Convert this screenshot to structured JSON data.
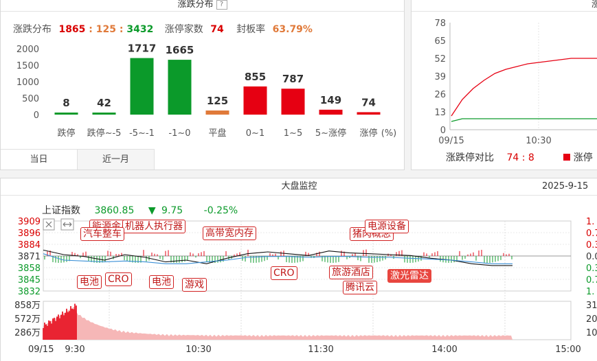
{
  "distribution": {
    "title": "涨跌分布",
    "help_icon": "?",
    "stat_label": "涨跌分布",
    "up_count": "1865",
    "sep1": " : ",
    "flat_count": "125",
    "sep2": " : ",
    "down_count": "3432",
    "limit_up_label": "涨停家数",
    "limit_up_value": "74",
    "seal_rate_label": "封板率",
    "seal_rate_value": "63.79%",
    "unit": "(%)",
    "tabs": [
      "当日",
      "近一月"
    ],
    "active_tab": 0
  },
  "ratio": {
    "title": "涨",
    "compare_label": "涨跌停对比",
    "compare_value": "74 : 8",
    "legend_label": "涨停",
    "y_ticks": [
      "78",
      "65",
      "52",
      "39",
      "26",
      "13",
      "0"
    ],
    "x_ticks": [
      "09/15",
      "10:30"
    ]
  },
  "monitor": {
    "title": "大盘监控",
    "date": "2025-9-15",
    "index_name": "上证指数",
    "index_value": "3860.85",
    "arrow": "▼",
    "change": "9.75",
    "change_pct": "-0.25%",
    "price_ticks": [
      "3909",
      "3896",
      "3884",
      "3871",
      "3858",
      "3845",
      "3832"
    ],
    "pct_ticks": [
      "1.",
      "0.7",
      "0.3",
      "0.0",
      "0.3",
      "0.7",
      "1."
    ],
    "vol_ticks": [
      "858万",
      "572万",
      "286万"
    ],
    "vol_right_ticks": [
      "31",
      "20",
      "10"
    ],
    "time_ticks": [
      "09/15",
      "9:30",
      "10:30",
      "11:30",
      "14:00",
      "15:00"
    ],
    "tags": [
      {
        "text": "能源金属",
        "style": "normal"
      },
      {
        "text": "机器人执行器",
        "style": "normal"
      },
      {
        "text": "汽车整车",
        "style": "normal"
      },
      {
        "text": "高带宽内存",
        "style": "normal"
      },
      {
        "text": "猪肉概念",
        "style": "normal"
      },
      {
        "text": "电源设备",
        "style": "normal"
      },
      {
        "text": "电池",
        "style": "normal"
      },
      {
        "text": "CRO",
        "style": "normal"
      },
      {
        "text": "电池",
        "style": "normal"
      },
      {
        "text": "游戏",
        "style": "normal"
      },
      {
        "text": "CRO",
        "style": "normal"
      },
      {
        "text": "旅游酒店",
        "style": "normal"
      },
      {
        "text": "腾讯云",
        "style": "normal"
      },
      {
        "text": "激光雷达",
        "style": "highlight"
      }
    ],
    "colors": {
      "up": "#e60012",
      "down": "#0b9a2a",
      "index_line": "#111111",
      "avg_line": "#3a8fd6"
    }
  },
  "chart_data": [
    {
      "type": "bar",
      "categories": [
        "跌停",
        "跌停~-5",
        "-5~-1",
        "-1~0",
        "平盘",
        "0~1",
        "1~5",
        "5~涨停",
        "涨停"
      ],
      "values": [
        8,
        42,
        1717,
        1665,
        125,
        855,
        787,
        149,
        74
      ],
      "colors": [
        "#0b9a2a",
        "#0b9a2a",
        "#0b9a2a",
        "#0b9a2a",
        "#e07a3a",
        "#e60012",
        "#e60012",
        "#e60012",
        "#e60012"
      ],
      "ylim": [
        0,
        2000
      ],
      "y_ticks": [
        0,
        500,
        1000,
        1500,
        2000
      ],
      "xlabel": "(%)",
      "grid": false
    },
    {
      "type": "line",
      "ylim": [
        0,
        78
      ],
      "series": [
        {
          "color": "#e60012",
          "values": [
            10,
            22,
            30,
            36,
            41,
            44,
            46,
            48,
            49,
            50,
            51,
            52,
            52,
            52,
            52
          ]
        },
        {
          "color": "#0b9a2a",
          "values": [
            6,
            8,
            8,
            8,
            8,
            8,
            8,
            8,
            8,
            8,
            8,
            8,
            8,
            8,
            8
          ]
        }
      ]
    },
    {
      "type": "line",
      "ylim": [
        3832,
        3909
      ],
      "series": [
        {
          "color": "#111111",
          "values": [
            3877,
            3872,
            3870,
            3866,
            3872,
            3869,
            3864,
            3866,
            3862,
            3868,
            3873,
            3875,
            3873,
            3871,
            3876,
            3874,
            3873,
            3872,
            3871,
            3868,
            3866,
            3862,
            3860,
            3860
          ]
        },
        {
          "color": "#3a8fd6",
          "values": [
            3873,
            3866,
            3865,
            3864,
            3865,
            3864,
            3862,
            3862,
            3864,
            3866,
            3869,
            3870,
            3870,
            3869,
            3870,
            3870,
            3869,
            3869,
            3868,
            3867,
            3866,
            3864,
            3862,
            3862
          ]
        }
      ]
    }
  ]
}
